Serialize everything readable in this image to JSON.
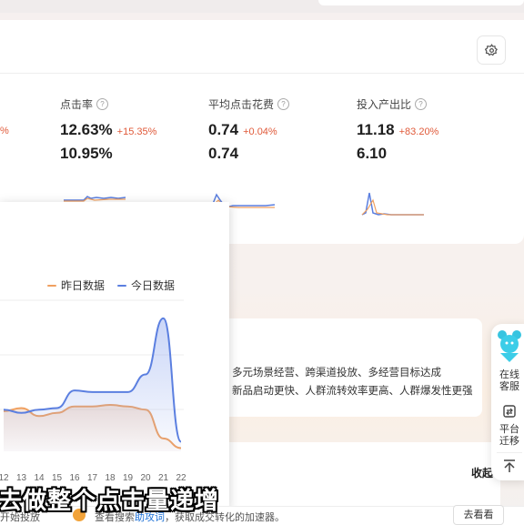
{
  "metrics": {
    "cut_left_change": "%",
    "ctr": {
      "label": "点击率",
      "today": "12.63%",
      "change": "+15.35%",
      "yesterday": "10.95%"
    },
    "cpc": {
      "label": "平均点击花费",
      "today": "0.74",
      "change": "+0.04%",
      "yesterday": "0.74"
    },
    "roi": {
      "label": "投入产出比",
      "today": "11.18",
      "change": "+83.20%",
      "yesterday": "6.10"
    },
    "help_glyph": "?"
  },
  "features": {
    "line1": "多元场景经营、跨渠道投放、多经营目标达成",
    "line2": "新品启动更快、人群流转效率更高、人群爆发性更强"
  },
  "bottom": {
    "collapse_label": "收起"
  },
  "sidebar": {
    "online_service": [
      "在线",
      "客服"
    ],
    "platform_migrate": [
      "平台",
      "迁移"
    ]
  },
  "ad_bar": {
    "left_text": "开始投放",
    "text_before": "查看搜索",
    "highlight": "助攻词",
    "text_after": "，获取成交转化的加速器。",
    "button": "去看看"
  },
  "subtitle": "去做整个点击量递增",
  "chart_data": {
    "type": "line",
    "x": [
      "12",
      "13",
      "14",
      "15",
      "16",
      "17",
      "18",
      "19",
      "20",
      "21",
      "22"
    ],
    "series": [
      {
        "name": "昨日数据",
        "color": "#f0a060",
        "values": [
          0.25,
          0.27,
          0.22,
          0.24,
          0.28,
          0.28,
          0.29,
          0.28,
          0.26,
          0.08,
          0.02
        ]
      },
      {
        "name": "今日数据",
        "color": "#5b7fe0",
        "values": [
          0.26,
          0.24,
          0.26,
          0.27,
          0.38,
          0.37,
          0.37,
          0.37,
          0.48,
          0.83,
          0.06
        ]
      }
    ],
    "grid": true,
    "legend_position": "top-right"
  }
}
